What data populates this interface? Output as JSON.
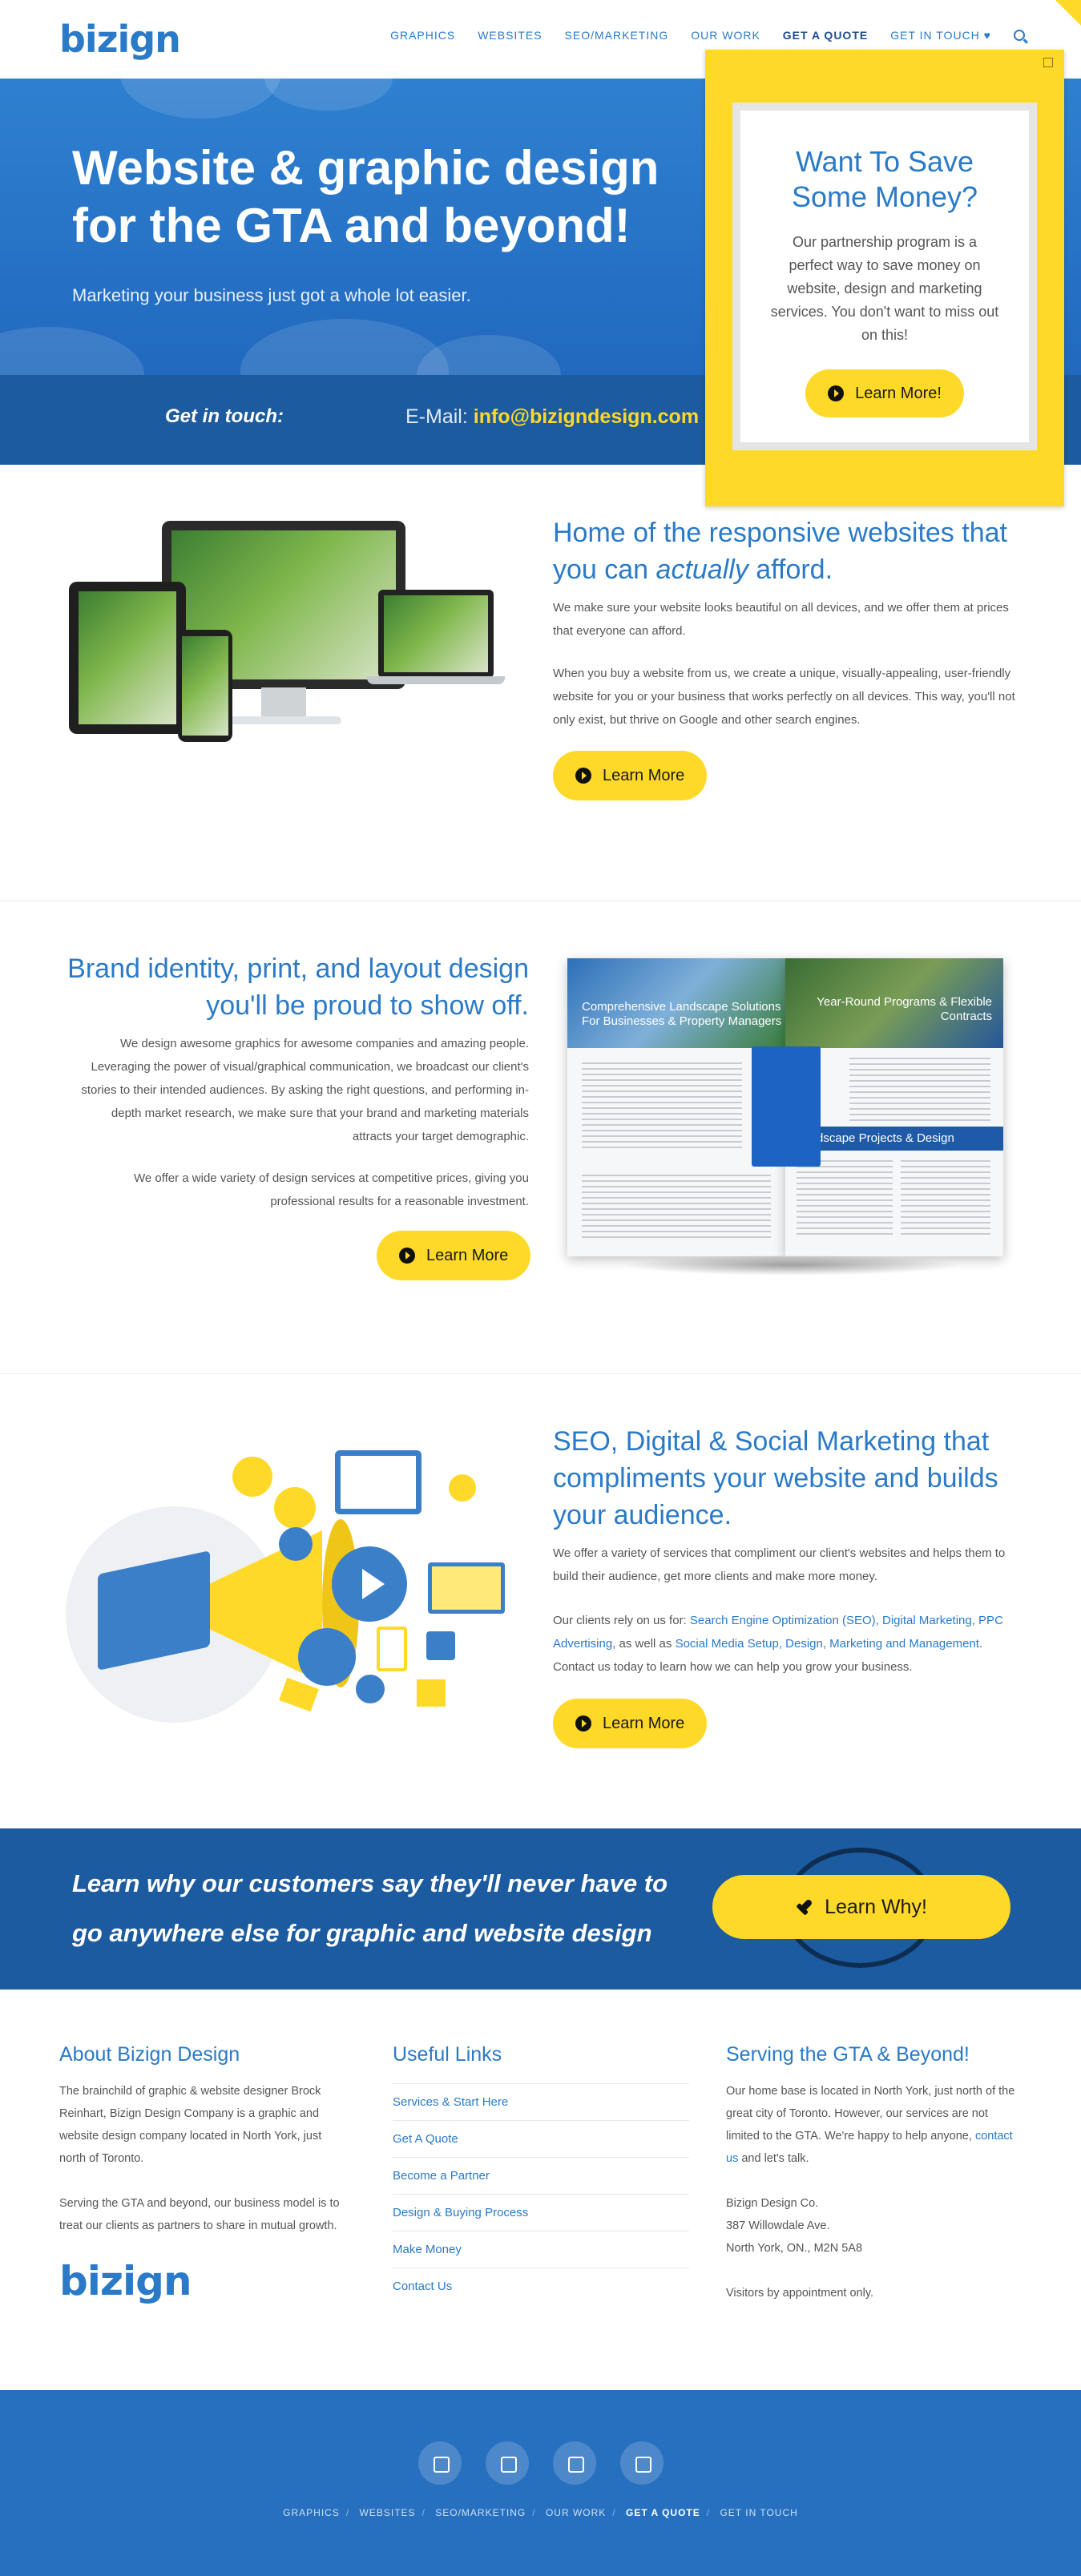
{
  "header": {
    "logo": "bizign",
    "nav": [
      {
        "label": "GRAPHICS"
      },
      {
        "label": "WEBSITES"
      },
      {
        "label": "SEO/MARKETING"
      },
      {
        "label": "OUR WORK"
      },
      {
        "label": "GET A QUOTE",
        "active": true
      },
      {
        "label": "GET IN TOUCH ♥"
      }
    ],
    "search_icon": "search-icon"
  },
  "hero": {
    "title": "Website & graphic design for the GTA and beyond!",
    "subtitle": "Marketing your business just got a whole lot easier."
  },
  "contact": {
    "label": "Get in touch:",
    "email_label": "E-Mail:",
    "email": "info@bizigndesign.com"
  },
  "popup": {
    "title": "Want To Save Some Money?",
    "text": "Our partnership program is a perfect way to save money on website, design and marketing services. You don't want to miss out on this!",
    "button": "Learn More!"
  },
  "section1": {
    "title_a": "Home of the responsive websites that you can ",
    "title_em": "actually",
    "title_b": " afford.",
    "p1": "We make sure your website looks beautiful on all devices, and we offer them at prices that everyone can afford.",
    "p2": "When you buy a website from us, we create a unique, visually-appealing, user-friendly website for you or your business that works perfectly on all devices. This way, you'll not only exist, but thrive on Google and other search engines.",
    "button": "Learn More"
  },
  "section2": {
    "title": "Brand identity, print, and layout design you'll be proud to show off.",
    "p1": "We design awesome graphics for awesome companies and amazing people. Leveraging the power of visual/graphical communication, we broadcast our client's stories to their intended audiences. By asking the right questions, and performing in-depth market research, we make sure that your brand and marketing materials attracts your target demographic.",
    "p2": "We offer a wide variety of design services at competitive prices, giving you professional results for a reasonable investment.",
    "button": "Learn More",
    "brochure_left": "Comprehensive Landscape Solutions For Businesses & Property Managers",
    "brochure_right": "Year-Round Programs & Flexible Contracts",
    "brochure_band": "Landscape Projects & Design"
  },
  "section3": {
    "title": "SEO, Digital & Social Marketing that compliments your website and builds your audience.",
    "p1": "We offer a variety of services that compliment our client's websites and helps them to build their audience, get more clients and make more money.",
    "p2_a": "Our clients rely on us for: ",
    "p2_links1": "Search Engine Optimization (SEO), Digital Marketing, PPC Advertising",
    "p2_b": ", as well as ",
    "p2_links2": "Social Media Setup, Design, Marketing and Management",
    "p2_c": ". Contact us today to learn how we can help you grow your business.",
    "button": "Learn More"
  },
  "cta": {
    "text": "Learn why our customers say they'll never have to go anywhere else for graphic and website design",
    "button": "Learn Why!"
  },
  "footer": {
    "about_title": "About Bizign Design",
    "about_p1": "The brainchild of graphic & website designer Brock Reinhart, Bizign Design Company is a graphic and website design company located in North York, just north of Toronto.",
    "about_p2": "Serving the GTA and beyond, our business model is to treat our clients as partners to share in mutual growth.",
    "logo": "bizign",
    "links_title": "Useful Links",
    "links": [
      "Services & Start Here",
      "Get A Quote",
      "Become a Partner",
      "Design & Buying Process",
      "Make Money",
      "Contact Us"
    ],
    "serving_title": "Serving the GTA & Beyond!",
    "serving_a": "Our home base is located in North York, just north of the great city of Toronto. However, our services are not limited to the GTA. We're happy to help anyone, ",
    "serving_link": "contact us",
    "serving_b": " and let's talk.",
    "address1": "Bizign Design Co.",
    "address2": "387 Willowdale Ave.",
    "address3": "North York, ON., M2N 5A8",
    "visitors": "Visitors by appointment only."
  },
  "bottom": {
    "socials": [
      "facebook-icon",
      "twitter-icon",
      "instagram-icon",
      "linkedin-icon"
    ],
    "nav": [
      "GRAPHICS",
      "WEBSITES",
      "SEO/MARKETING",
      "OUR WORK",
      "GET A QUOTE",
      "GET IN TOUCH"
    ]
  },
  "colors": {
    "brand_blue": "#2a7ac8",
    "dark_blue": "#1c5b9f",
    "accent_yellow": "#ffd928"
  }
}
